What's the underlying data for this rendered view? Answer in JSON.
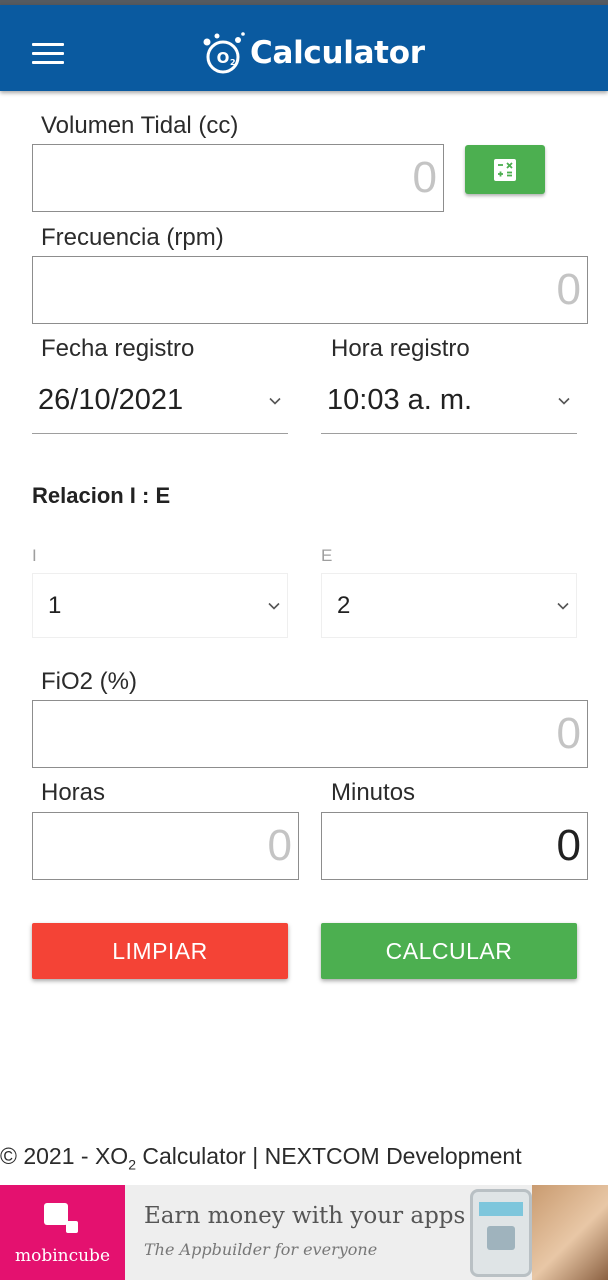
{
  "app_bar": {
    "title": "Calculator",
    "background_color": "#0a5aa0",
    "menu_icon": "hamburger-menu-icon",
    "logo_icon": "o2-bubble-logo-icon"
  },
  "form": {
    "tidal_volume": {
      "label": "Volumen Tidal (cc)",
      "placeholder": "0",
      "value": ""
    },
    "calculator_button": {
      "icon": "calculator-icon",
      "color": "#4caf50"
    },
    "frequency": {
      "label": "Frecuencia (rpm)",
      "placeholder": "0",
      "value": ""
    },
    "record_date": {
      "label": "Fecha registro",
      "value": "26/10/2021"
    },
    "record_time": {
      "label": "Hora registro",
      "value": "10:03 a. m."
    },
    "ie_ratio": {
      "title": "Relacion I : E",
      "i_label": "I",
      "i_value": "1",
      "e_label": "E",
      "e_value": "2"
    },
    "fio2": {
      "label": "FiO2 (%)",
      "placeholder": "0",
      "value": ""
    },
    "hours": {
      "label": "Horas",
      "placeholder": "0",
      "value": ""
    },
    "minutes": {
      "label": "Minutos",
      "placeholder": "0",
      "value": "0"
    }
  },
  "actions": {
    "clear_label": "LIMPIAR",
    "clear_color": "#f44336",
    "calculate_label": "CALCULAR",
    "calculate_color": "#4caf50"
  },
  "footer": {
    "prefix": "© 2021 - XO",
    "subscript": "2",
    "suffix": " Calculator | NEXTCOM Development"
  },
  "ad": {
    "brand": "mobincube",
    "headline": "Earn money with your apps",
    "tagline": "The Appbuilder for everyone",
    "brand_color": "#e4116f"
  }
}
